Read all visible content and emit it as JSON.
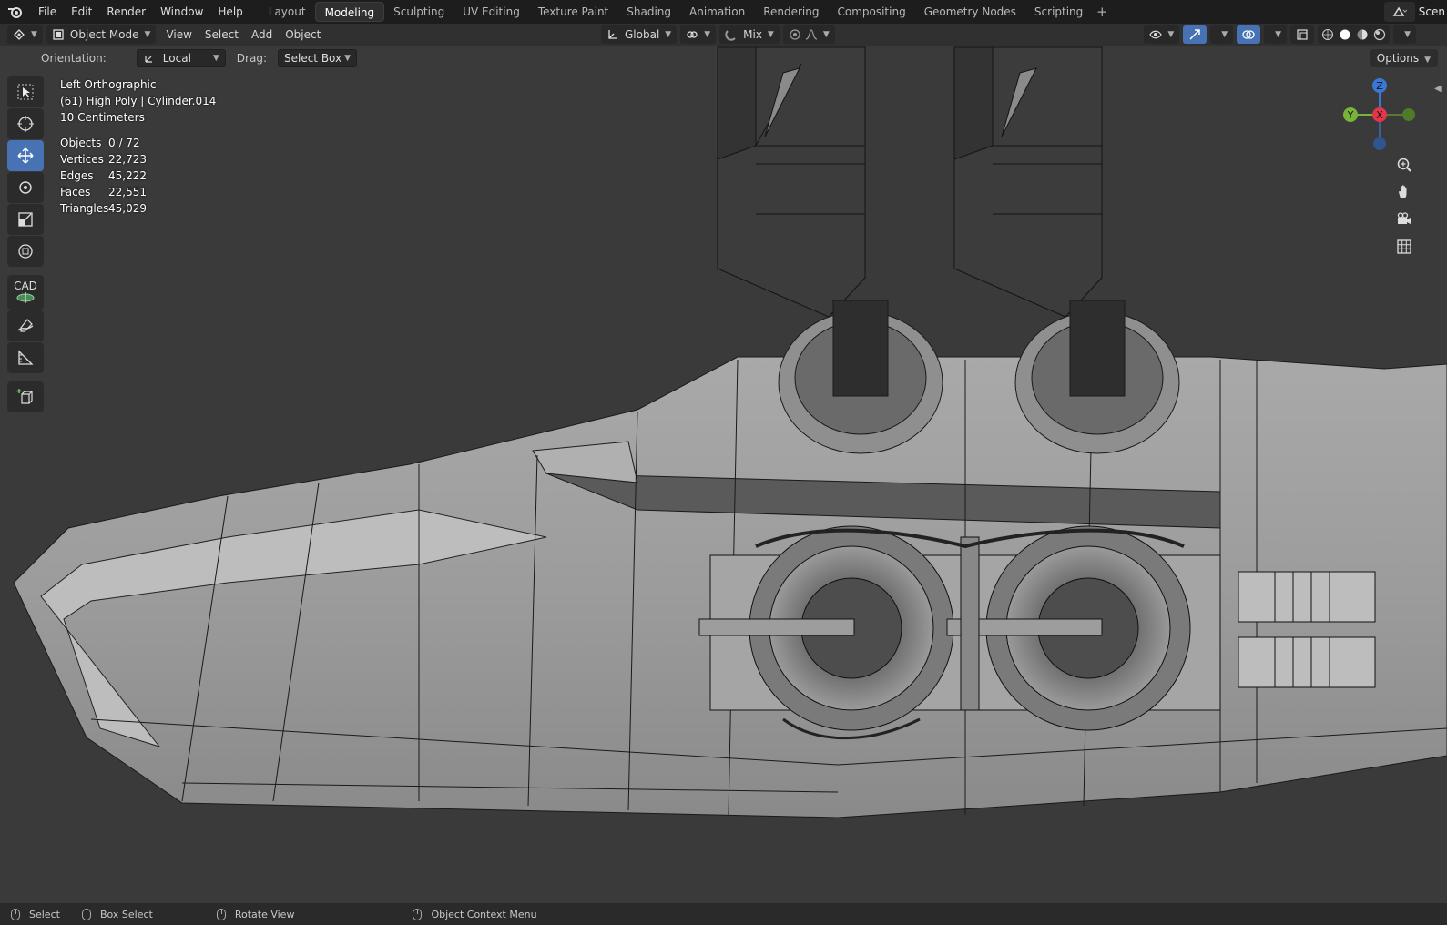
{
  "menu": [
    "File",
    "Edit",
    "Render",
    "Window",
    "Help"
  ],
  "workspaces": [
    "Layout",
    "Modeling",
    "Sculpting",
    "UV Editing",
    "Texture Paint",
    "Shading",
    "Animation",
    "Rendering",
    "Compositing",
    "Geometry Nodes",
    "Scripting"
  ],
  "active_workspace": "Modeling",
  "scene_label": "Scen",
  "header": {
    "mode": "Object Mode",
    "menus": [
      "View",
      "Select",
      "Add",
      "Object"
    ],
    "transform_orientation": "Global",
    "snap_mode": "Mix"
  },
  "tool_settings": {
    "orientation_label": "Orientation:",
    "orientation_value": "Local",
    "drag_label": "Drag:",
    "drag_value": "Select Box",
    "options": "Options"
  },
  "viewport": {
    "view_name": "Left Orthographic",
    "collection_info": "(61) High Poly | Cylinder.014",
    "scale": "10 Centimeters",
    "stats": [
      {
        "key": "Objects",
        "value": "0 / 72"
      },
      {
        "key": "Vertices",
        "value": "22,723"
      },
      {
        "key": "Edges",
        "value": "45,222"
      },
      {
        "key": "Faces",
        "value": "22,551"
      },
      {
        "key": "Triangles",
        "value": "45,029"
      }
    ]
  },
  "toolbar": {
    "cad_label": "CAD",
    "tools": [
      "select-box",
      "cursor",
      "move",
      "rotate",
      "scale",
      "transform",
      "cad",
      "annotate",
      "measure",
      "add-cube"
    ],
    "active_tool": "move"
  },
  "gizmo": {
    "z": "Z",
    "y": "Y",
    "x": "X",
    "x_color": "#e4364b",
    "y_color": "#7ab33a",
    "z_color": "#3a78d6"
  },
  "statusbar": [
    "Select",
    "Box Select",
    "Rotate View",
    "Object Context Menu"
  ],
  "colors": {
    "accent": "#4772b3",
    "background": "#3a3a3a",
    "topbar": "#1d1d1d"
  }
}
